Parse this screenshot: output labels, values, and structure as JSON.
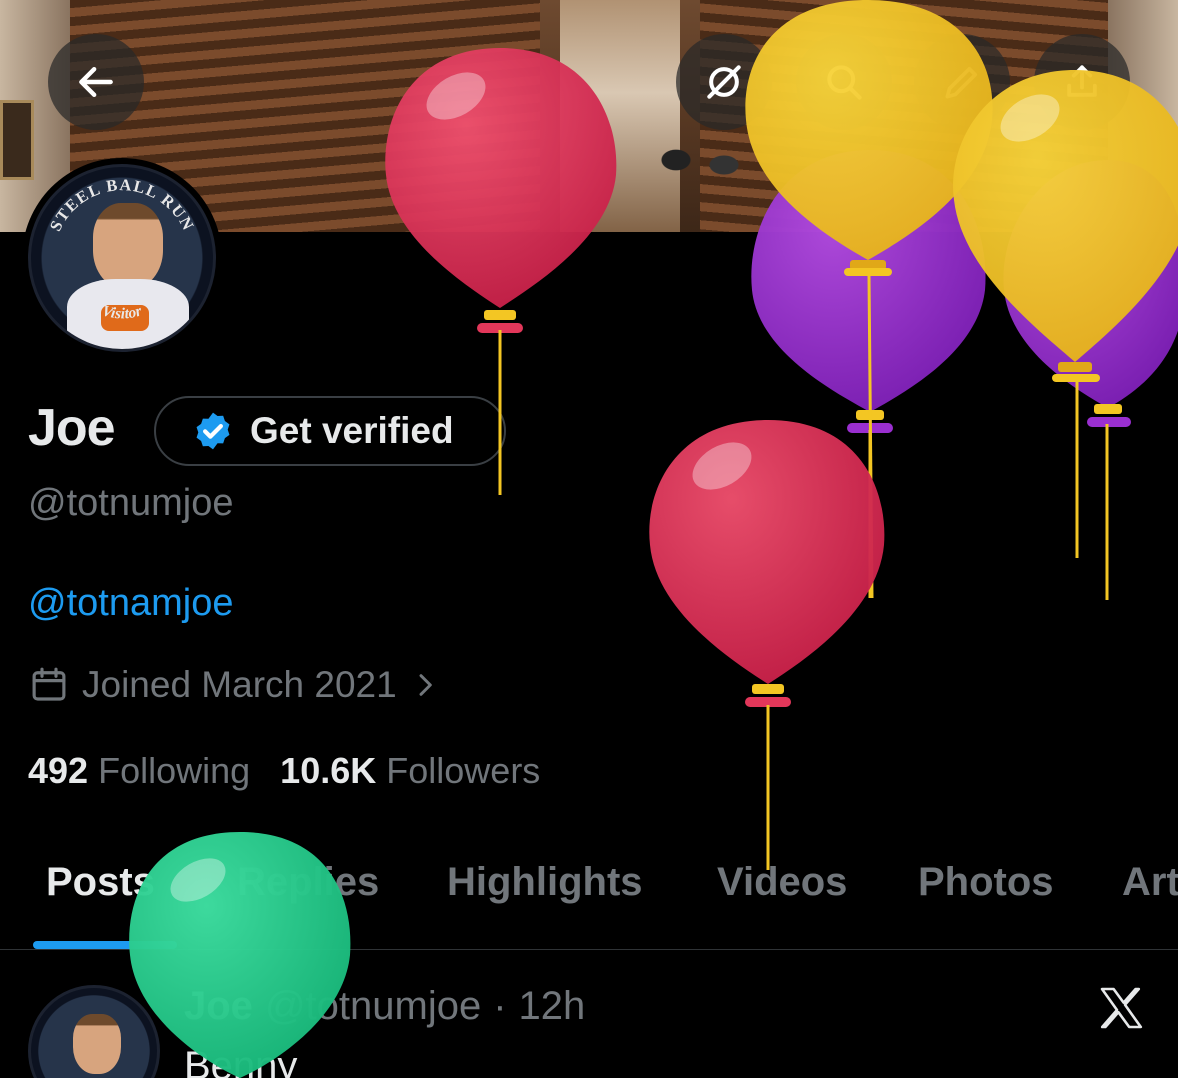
{
  "header": {
    "back_icon": "arrow-left-icon",
    "actions": [
      {
        "icon": "grok-icon"
      },
      {
        "icon": "search-icon"
      },
      {
        "icon": "pencil-icon"
      },
      {
        "icon": "share-icon"
      }
    ]
  },
  "avatar": {
    "ring_top_text": "STEEL BALL RUN",
    "ring_bottom_text": "Visitor"
  },
  "profile": {
    "name": "Joe",
    "verify_label": "Get verified",
    "handle": "@totnumjoe",
    "bio_link": "@totnamjoe",
    "joined": "Joined March 2021",
    "following_count": "492",
    "following_label": "Following",
    "followers_count": "10.6K",
    "followers_label": "Followers"
  },
  "tabs": [
    {
      "label": "Posts",
      "active": true
    },
    {
      "label": "Replies",
      "active": false
    },
    {
      "label": "Highlights",
      "active": false
    },
    {
      "label": "Videos",
      "active": false
    },
    {
      "label": "Photos",
      "active": false
    },
    {
      "label": "Art",
      "active": false
    }
  ],
  "post": {
    "author": "Joe",
    "handle": "@totnumjoe",
    "separator": "·",
    "time": "12h",
    "text": "Benny"
  },
  "colors": {
    "accent": "#1d9bf0",
    "muted": "#71767b",
    "text": "#e7e9ea",
    "balloon_red": "#e2375a",
    "balloon_yellow": "#f3c623",
    "balloon_purple": "#9a2fd0",
    "balloon_green": "#2fd092"
  }
}
